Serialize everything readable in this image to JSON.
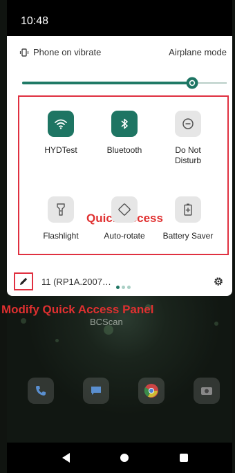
{
  "status_bar": {
    "time": "10:48"
  },
  "quick_settings": {
    "vibrate_label": "Phone on vibrate",
    "airplane_label": "Airplane mode",
    "brightness": 0.83,
    "tiles": [
      {
        "label": "HYDTest",
        "state": "on",
        "icon": "wifi-icon"
      },
      {
        "label": "Bluetooth",
        "state": "on",
        "icon": "bluetooth-icon"
      },
      {
        "label": "Do Not Disturb",
        "state": "off",
        "icon": "do-not-disturb-icon"
      },
      {
        "label": "Flashlight",
        "state": "off",
        "icon": "flashlight-icon"
      },
      {
        "label": "Auto-rotate",
        "state": "off",
        "icon": "auto-rotate-icon"
      },
      {
        "label": "Battery Saver",
        "state": "off",
        "icon": "battery-saver-icon"
      }
    ],
    "annotation_title": "Quick Access",
    "build_label": "11 (RP1A.2007…",
    "page_count": 3,
    "active_page": 1
  },
  "annotation_modify": "Modify Quick Access Panel",
  "home": {
    "app_label": "BCScan"
  },
  "colors": {
    "accent": "#1e7563",
    "annotation": "#e03030"
  }
}
